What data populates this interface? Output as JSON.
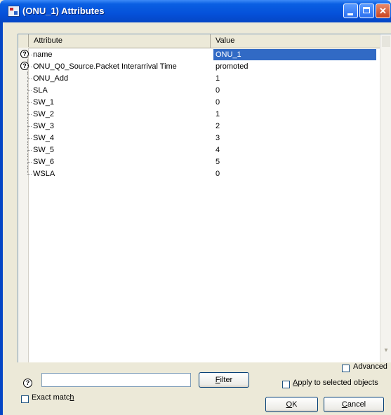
{
  "window": {
    "title": "(ONU_1) Attributes",
    "icon": "app-icon",
    "controls": [
      "minimize-icon",
      "maximize-icon",
      "close-icon"
    ]
  },
  "grid": {
    "columns": {
      "attribute": "Attribute",
      "value": "Value"
    },
    "rows": [
      {
        "name": "name",
        "value": "ONU_1",
        "help": true,
        "selected": true
      },
      {
        "name": "ONU_Q0_Source.Packet Interarrival Time",
        "value": "promoted",
        "help": true
      },
      {
        "name": "ONU_Add",
        "value": "1"
      },
      {
        "name": "SLA",
        "value": "0"
      },
      {
        "name": "SW_1",
        "value": "0"
      },
      {
        "name": "SW_2",
        "value": "1"
      },
      {
        "name": "SW_3",
        "value": "2"
      },
      {
        "name": "SW_4",
        "value": "3"
      },
      {
        "name": "SW_5",
        "value": "4"
      },
      {
        "name": "SW_6",
        "value": "5"
      },
      {
        "name": "WSLA",
        "value": "0"
      }
    ]
  },
  "filter": {
    "value": "",
    "button_label": "Filter",
    "button_mnemonic": "F",
    "button_rest": "ilter"
  },
  "options": {
    "exact_match": {
      "label_pre": "Exact matc",
      "mnemonic": "h",
      "checked": false
    },
    "advanced": {
      "label": "Advanced",
      "checked": false
    },
    "apply_selected": {
      "label_pre": "",
      "mnemonic": "A",
      "label_post": "pply to selected objects",
      "checked": false
    }
  },
  "buttons": {
    "ok": {
      "mnemonic": "O",
      "rest": "K"
    },
    "cancel": {
      "mnemonic": "C",
      "rest": "ancel"
    }
  },
  "colors": {
    "titlebar": "#0551da",
    "selection": "#316ac5",
    "dialog_bg": "#ece9d8"
  }
}
